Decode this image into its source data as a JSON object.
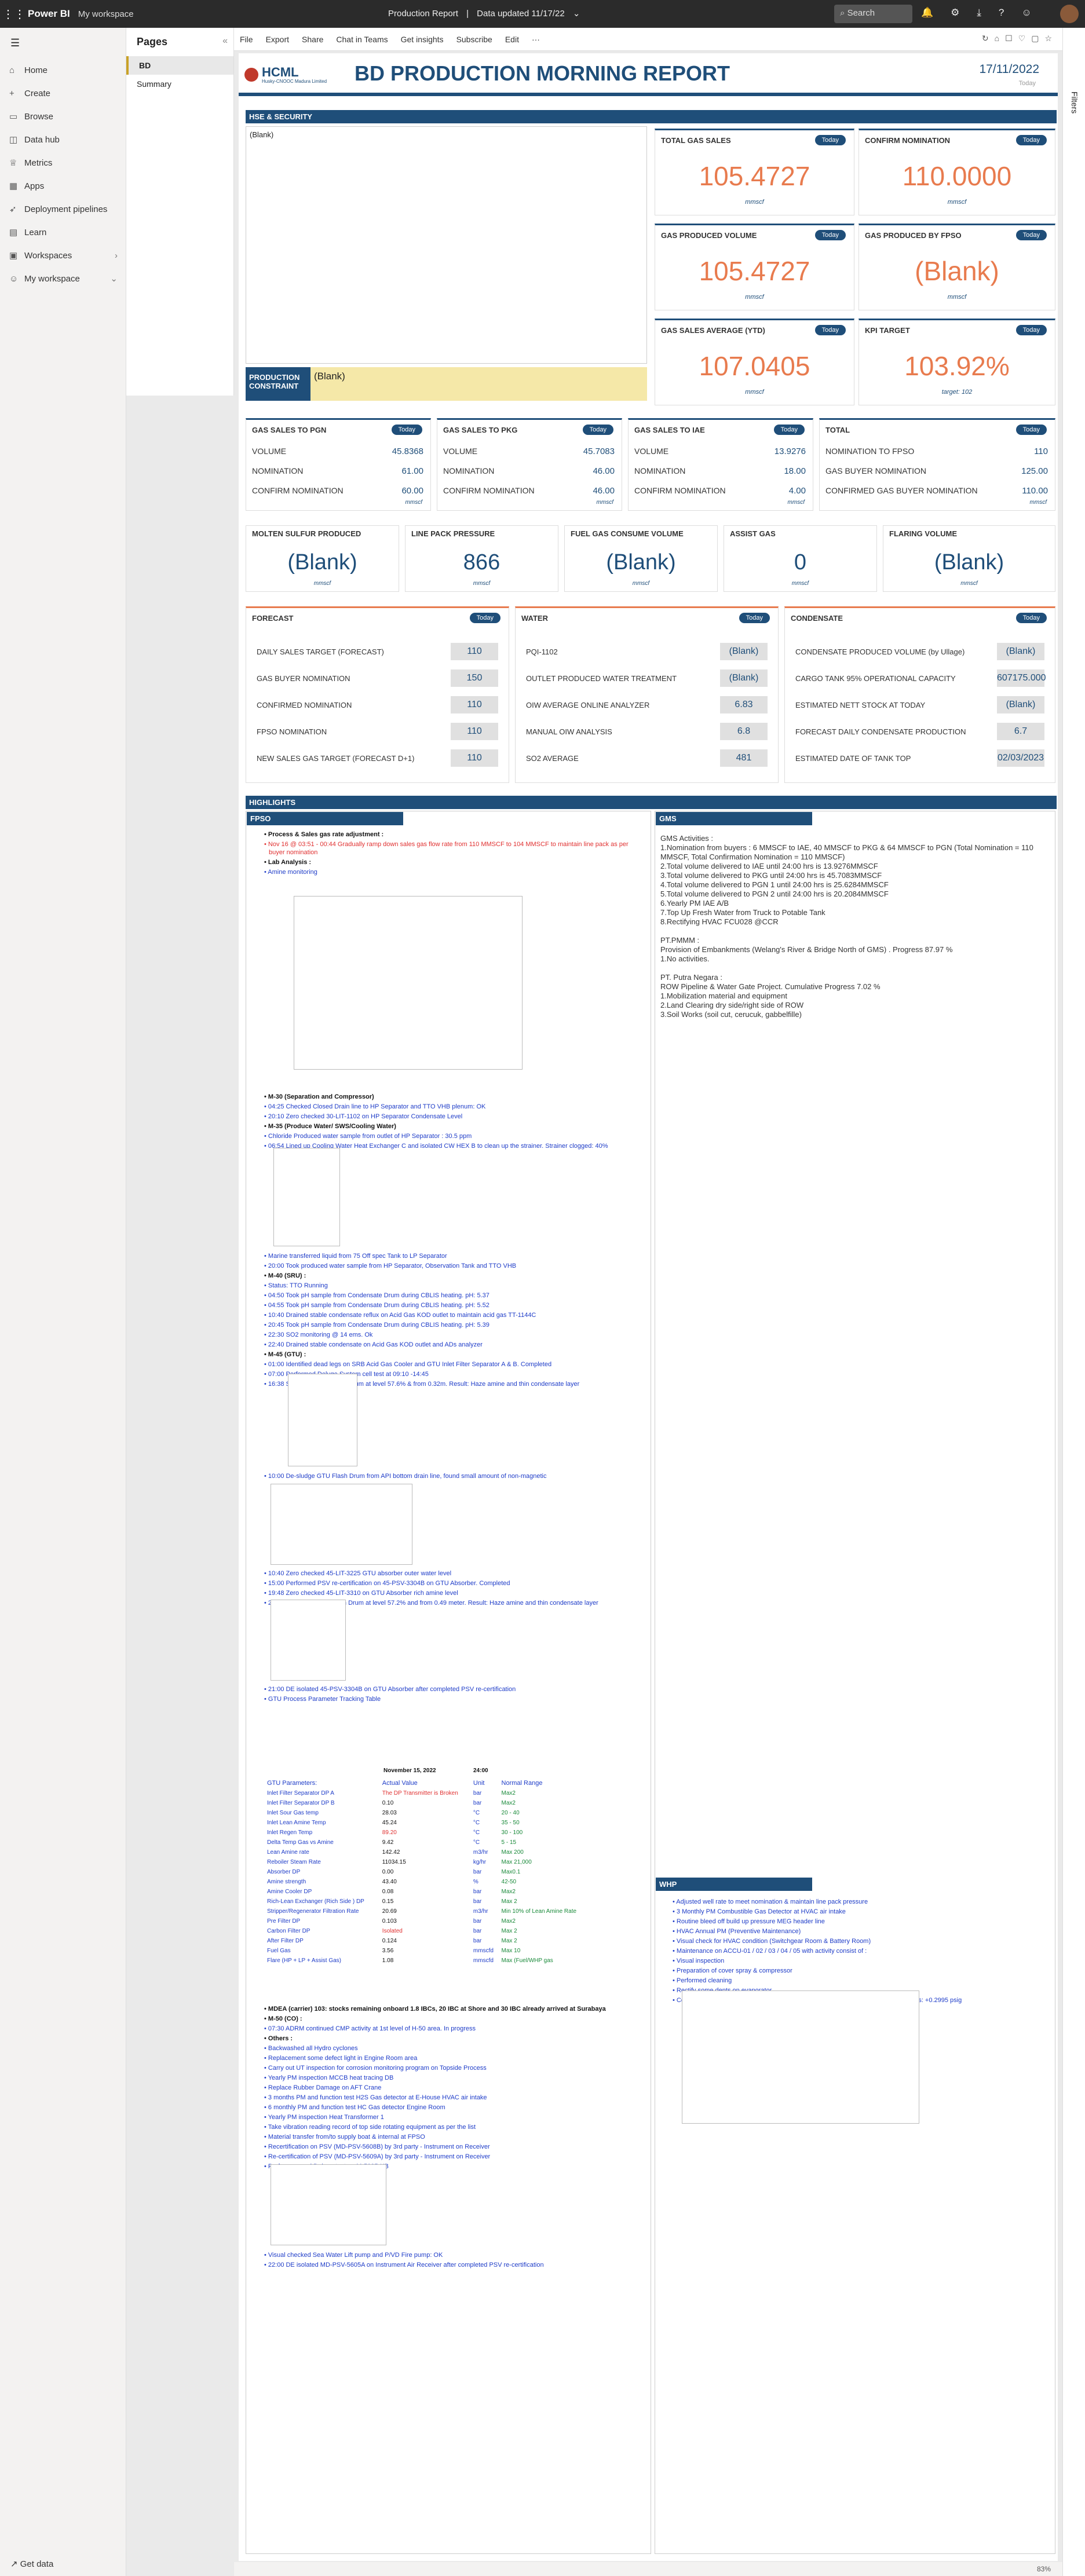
{
  "app": {
    "brand": "Power BI",
    "workspace": "My workspace",
    "report_title": "Production Report",
    "updated": "Data updated 11/17/22",
    "search_placeholder": "Search"
  },
  "nav": {
    "items": [
      "Home",
      "Create",
      "Browse",
      "Data hub",
      "Metrics",
      "Apps",
      "Deployment pipelines",
      "Learn",
      "Workspaces",
      "My workspace"
    ],
    "get_data": "Get data"
  },
  "pages": {
    "title": "Pages",
    "items": [
      "BD",
      "Summary"
    ]
  },
  "toolbar": {
    "items": [
      "File",
      "Export",
      "Share",
      "Chat in Teams",
      "Get insights",
      "Subscribe",
      "Edit"
    ]
  },
  "filters": "Filters",
  "zoom": "83%",
  "report": {
    "logo_text": "HCML",
    "logo_sub": "Husky-CNOOC Madura Limited",
    "title": "BD PRODUCTION MORNING REPORT",
    "date": "17/11/2022",
    "day": "Today",
    "hse_label": "HSE & SECURITY",
    "hse_value": "(Blank)",
    "prod_constraint_label": "PRODUCTION CONSTRAINT",
    "prod_constraint_value": "(Blank)",
    "today": "Today",
    "unit": "mmscf",
    "kpis": [
      {
        "title": "TOTAL GAS SALES",
        "value": "105.4727",
        "unit": "mmscf"
      },
      {
        "title": "CONFIRM NOMINATION",
        "value": "110.0000",
        "unit": "mmscf"
      },
      {
        "title": "GAS PRODUCED VOLUME",
        "value": "105.4727",
        "unit": "mmscf"
      },
      {
        "title": "GAS PRODUCED BY FPSO",
        "value": "(Blank)",
        "unit": "mmscf"
      },
      {
        "title": "GAS SALES AVERAGE (YTD)",
        "value": "107.0405",
        "unit": "mmscf"
      },
      {
        "title": "KPI TARGET",
        "value": "103.92%",
        "unit": "target: 102"
      }
    ],
    "sales": [
      {
        "title": "GAS SALES TO PGN",
        "rows": [
          [
            "VOLUME",
            "45.8368"
          ],
          [
            "NOMINATION",
            "61.00"
          ],
          [
            "CONFIRM NOMINATION",
            "60.00"
          ]
        ],
        "unit": "mmscf"
      },
      {
        "title": "GAS SALES TO PKG",
        "rows": [
          [
            "VOLUME",
            "45.7083"
          ],
          [
            "NOMINATION",
            "46.00"
          ],
          [
            "CONFIRM NOMINATION",
            "46.00"
          ]
        ],
        "unit": "mmscf"
      },
      {
        "title": "GAS SALES TO IAE",
        "rows": [
          [
            "VOLUME",
            "13.9276"
          ],
          [
            "NOMINATION",
            "18.00"
          ],
          [
            "CONFIRM NOMINATION",
            "4.00"
          ]
        ],
        "unit": "mmscf"
      },
      {
        "title": "TOTAL",
        "rows": [
          [
            "NOMINATION TO FPSO",
            "110"
          ],
          [
            "GAS BUYER NOMINATION",
            "125.00"
          ],
          [
            "CONFIRMED GAS BUYER NOMINATION",
            "110.00"
          ]
        ],
        "unit": "mmscf"
      }
    ],
    "misc": [
      {
        "title": "MOLTEN SULFUR PRODUCED",
        "value": "(Blank)",
        "unit": "mmscf"
      },
      {
        "title": "LINE PACK PRESSURE",
        "value": "866",
        "unit": "mmscf"
      },
      {
        "title": "FUEL GAS CONSUME VOLUME",
        "value": "(Blank)",
        "unit": "mmscf"
      },
      {
        "title": "ASSIST GAS",
        "value": "0",
        "unit": "mmscf"
      },
      {
        "title": "FLARING VOLUME",
        "value": "(Blank)",
        "unit": "mmscf"
      }
    ],
    "forecast": {
      "title": "FORECAST",
      "rows": [
        [
          "DAILY SALES TARGET (FORECAST)",
          "110"
        ],
        [
          "GAS BUYER NOMINATION",
          "150"
        ],
        [
          "CONFIRMED NOMINATION",
          "110"
        ],
        [
          "FPSO NOMINATION",
          "110"
        ],
        [
          "NEW SALES GAS TARGET (FORECAST D+1)",
          "110"
        ]
      ]
    },
    "water": {
      "title": "WATER",
      "rows": [
        [
          "PQI-1102",
          "(Blank)"
        ],
        [
          "OUTLET PRODUCED WATER TREATMENT",
          "(Blank)"
        ],
        [
          "OIW AVERAGE ONLINE ANALYZER",
          "6.83"
        ],
        [
          "MANUAL OIW ANALYSIS",
          "6.8"
        ],
        [
          "SO2 AVERAGE",
          "481"
        ]
      ]
    },
    "condensate": {
      "title": "CONDENSATE",
      "rows": [
        [
          "CONDENSATE PRODUCED VOLUME (by Ullage)",
          "(Blank)"
        ],
        [
          "CARGO TANK 95% OPERATIONAL CAPACITY",
          "607175.000"
        ],
        [
          "ESTIMATED NETT STOCK AT TODAY",
          "(Blank)"
        ],
        [
          "FORECAST DAILY CONDENSATE PRODUCTION",
          "6.7"
        ],
        [
          "ESTIMATED DATE OF TANK TOP",
          "02/03/2023"
        ]
      ]
    },
    "highlights": "HIGHLIGHTS",
    "fpso": "FPSO",
    "gms_label": "GMS",
    "whp_label": "WHP",
    "fpso_lines_a": [
      {
        "t": "Process & Sales gas rate adjustment :",
        "c": "blk"
      },
      {
        "t": "Nov 16 @ 03:51 - 00:44 Gradually ramp down sales gas flow rate from 110 MMSCF to 104 MMSCF to maintain line pack as per buyer nomination",
        "c": "red"
      },
      {
        "t": "Lab Analysis :",
        "c": "blk"
      },
      {
        "t": "Amine monitoring",
        "c": ""
      }
    ],
    "fpso_lines_b": [
      {
        "t": "M-30 (Separation and Compressor)",
        "c": "blk"
      },
      {
        "t": "04:25 Checked Closed Drain line to HP Separator and TTO VHB plenum: OK",
        "c": ""
      },
      {
        "t": "20:10 Zero checked 30-LIT-1102 on HP Separator Condensate Level",
        "c": ""
      },
      {
        "t": "M-35 (Produce Water/ SWS/Cooling Water)",
        "c": "blk"
      },
      {
        "t": "Chloride Produced water sample from outlet of HP Separator : 30.5 ppm",
        "c": ""
      },
      {
        "t": "06:54 Lined up Cooling Water Heat Exchanger C and isolated CW HEX B to clean up the strainer. Strainer clogged: 40%",
        "c": ""
      }
    ],
    "fpso_lines_c": [
      {
        "t": "Marine transferred liquid from 75 Off spec Tank to LP Separator",
        "c": ""
      },
      {
        "t": "20:00 Took produced water sample from HP Separator, Observation Tank and TTO VHB",
        "c": ""
      },
      {
        "t": "M-40 (SRU) :",
        "c": "blk"
      },
      {
        "t": "Status: TTO Running",
        "c": ""
      },
      {
        "t": "04:50 Took pH sample from Condensate Drum during CBLIS heating. pH: 5.37",
        "c": ""
      },
      {
        "t": "04:55 Took pH sample from Condensate Drum during CBLIS heating. pH: 5.52",
        "c": ""
      },
      {
        "t": "10:40 Drained stable condensate reflux on Acid Gas KOD outlet to maintain acid gas TT-1144C",
        "c": ""
      },
      {
        "t": "20:45 Took pH sample from Condensate Drum during CBLIS heating. pH: 5.39",
        "c": ""
      },
      {
        "t": "22:30 SO2 monitoring @ 14 ems. Ok",
        "c": ""
      },
      {
        "t": "22:40 Drained stable condensate on Acid Gas KOD outlet and ADs analyzer",
        "c": ""
      },
      {
        "t": "M-45 (GTU) :",
        "c": "blk"
      },
      {
        "t": "01:00 Identified dead legs on SRB Acid Gas Cooler and GTU Inlet Filter Separator A & B. Completed",
        "c": ""
      },
      {
        "t": "07:00 Performed Deluge System cell test at 09:10 -14:45",
        "c": ""
      },
      {
        "t": "16:38 Skimming GTU Flash Drum at level 57.6% & from 0.32m. Result: Haze amine and thin condensate layer",
        "c": ""
      }
    ],
    "fpso_lines_d": [
      {
        "t": "10:00 De-sludge GTU Flash Drum from API bottom drain line, found small amount of non-magnetic",
        "c": ""
      }
    ],
    "fpso_lines_e": [
      {
        "t": "10:40 Zero checked 45-LIT-3225 GTU absorber outer water level",
        "c": ""
      },
      {
        "t": "15:00 Performed PSV re-certification on 45-PSV-3304B on GTU Absorber. Completed",
        "c": ""
      },
      {
        "t": "19:48 Zero checked 45-LIT-3310 on GTU Absorber rich amine level",
        "c": ""
      },
      {
        "t": "20:55 Skimming GTU Flash Drum at level 57.2% and from 0.49 meter. Result: Haze amine and thin condensate layer",
        "c": ""
      }
    ],
    "fpso_lines_f": [
      {
        "t": "21:00 DE isolated 45-PSV-3304B on GTU Absorber after completed PSV re-certification",
        "c": ""
      },
      {
        "t": "GTU Process Parameter Tracking Table",
        "c": ""
      }
    ],
    "gtu": {
      "date": "November 15, 2022",
      "time": "24:00",
      "headers": [
        "GTU Parameters:",
        "Actual Value",
        "Unit",
        "Normal Range"
      ],
      "rows": [
        [
          "Inlet Filter Separator DP A",
          "The DP Transmitter is Broken",
          "bar",
          "Max2"
        ],
        [
          "Inlet Filter Separator DP B",
          "0.10",
          "bar",
          "Max2"
        ],
        [
          "Inlet Sour Gas temp",
          "28.03",
          "°C",
          "20 - 40"
        ],
        [
          "Inlet Lean Amine Temp",
          "45.24",
          "°C",
          "35 - 50"
        ],
        [
          "Inlet Regen Temp",
          "89.20",
          "°C",
          "30 - 100"
        ],
        [
          "Delta Temp Gas vs Amine",
          "9.42",
          "°C",
          "5 - 15"
        ],
        [
          "Lean Amine rate",
          "142.42",
          "m3/hr",
          "Max 200"
        ],
        [
          "Reboiler Steam Rate",
          "11034.15",
          "kg/hr",
          "Max 21,000"
        ],
        [
          "Absorber DP",
          "0.00",
          "bar",
          "Max0.1"
        ],
        [
          "Amine strength",
          "43.40",
          "%",
          "42-50"
        ],
        [
          "Amine Cooler DP",
          "0.08",
          "bar",
          "Max2"
        ],
        [
          "Rich-Lean Exchanger (Rich Side ) DP",
          "0.15",
          "bar",
          "Max 2"
        ],
        [
          "Stripper/Regenerator Filtration Rate",
          "20.69",
          "m3/hr",
          "Min 10% of Lean Amine Rate"
        ],
        [
          "Pre Filter DP",
          "0.103",
          "bar",
          "Max2"
        ],
        [
          "Carbon Filter DP",
          "Isolated",
          "bar",
          "Max 2"
        ],
        [
          "After Filter DP",
          "0.124",
          "bar",
          "Max 2"
        ],
        [
          "Fuel Gas",
          "3.56",
          "mmscfd",
          "Max 10"
        ],
        [
          "Flare (HP + LP + Assist Gas)",
          "1.08",
          "mmscfd",
          "Max (Fuel/WHP gas"
        ]
      ]
    },
    "fpso_lines_g": [
      {
        "t": "MDEA (carrier) 103: stocks remaining onboard 1.8 IBCs, 20 IBC at Shore and 30 IBC already arrived at Surabaya",
        "c": "blk"
      },
      {
        "t": "M-50 (CO) :",
        "c": "blk"
      },
      {
        "t": "07:30 ADRM continued CMP activity at 1st level of H-50 area. In progress",
        "c": ""
      },
      {
        "t": "Others :",
        "c": "blk"
      },
      {
        "t": "Backwashed all Hydro cyclones",
        "c": ""
      },
      {
        "t": "Replacement some defect light in Engine Room area",
        "c": ""
      },
      {
        "t": "Carry out UT inspection for corrosion monitoring program on Topside Process",
        "c": ""
      },
      {
        "t": "Yearly PM inspection MCCB heat tracing DB",
        "c": ""
      },
      {
        "t": "Replace Rubber Damage on AFT Crane",
        "c": ""
      },
      {
        "t": "3 months PM and function test H2S Gas detector at E-House HVAC air intake",
        "c": ""
      },
      {
        "t": "6 monthly PM and function test HC Gas detector Engine Room",
        "c": ""
      },
      {
        "t": "Yearly PM inspection Heat Transformer 1",
        "c": ""
      },
      {
        "t": "Take vibration reading record of top side rotating equipment as per the list",
        "c": ""
      },
      {
        "t": "Material transfer from/to supply boat & internal at FPSO",
        "c": ""
      },
      {
        "t": "Recertification on PSV (MD-PSV-5608B) by 3rd party - Instrument on Receiver",
        "c": ""
      },
      {
        "t": "Re-certification of PSV (MD-PSV-5609A) by 3rd party - Instrument on Receiver",
        "c": ""
      },
      {
        "t": "Perform annual Deluge test on M-5095-KB",
        "c": ""
      }
    ],
    "fpso_lines_h": [
      {
        "t": "Visual checked Sea Water Lift pump and P/VD Fire pump: OK",
        "c": ""
      },
      {
        "t": "22:00 DE isolated MD-PSV-5605A on Instrument Air Receiver after completed PSV re-certification",
        "c": ""
      }
    ],
    "gms_text": [
      "GMS Activities :",
      "1.Nomination from buyers : 6 MMSCF to IAE, 40 MMSCF to PKG & 64 MMSCF to PGN (Total Nomination = 110 MMSCF, Total Confirmation Nomination = 110 MMSCF)",
      "2.Total volume delivered to IAE until 24:00 hrs is 13.9276MMSCF",
      "3.Total volume delivered to PKG until 24:00 hrs is 45.7083MMSCF",
      "4.Total volume delivered to PGN 1 until 24:00 hrs is 25.6284MMSCF",
      "5.Total volume delivered to PGN 2 until 24:00 hrs is 20.2084MMSCF",
      "6.Yearly PM IAE A/B",
      "7.Top Up Fresh Water from Truck to Potable Tank",
      "8.Rectifying HVAC FCU028 @CCR",
      "",
      "PT.PMMM :",
      "Provision of Embankments (Welang's River & Bridge North of GMS) . Progress 87.97 %",
      "1.No activities.",
      "",
      "PT. Putra Negara :",
      "ROW Pipeline & Water Gate Project. Cumulative Progress 7.02 %",
      "1.Mobilization material and equipment",
      "2.Land Clearing dry side/right side of ROW",
      "3.Soil Works (soil cut, cerucuk, gabbelfille)"
    ],
    "whp_lines": [
      {
        "t": "Adjusted well rate to meet nomination & maintain line pack pressure",
        "c": ""
      },
      {
        "t": "3 Monthly PM Combustible Gas Detector at HVAC air intake",
        "c": ""
      },
      {
        "t": "Routine bleed off build up pressure MEG header line",
        "c": ""
      },
      {
        "t": "HVAC Annual PM (Preventive Maintenance)",
        "c": ""
      },
      {
        "t": "Visual check for HVAC condition (Switchgear Room & Battery Room)",
        "c": ""
      },
      {
        "t": "Maintenance on ACCU-01 / 02 / 03 / 04 / 05 with activity consist of :",
        "c": ""
      },
      {
        "t": "Visual inspection",
        "c": ""
      },
      {
        "t": "Preparation of cover spray & compressor",
        "c": ""
      },
      {
        "t": "Performed cleaning",
        "c": ""
      },
      {
        "t": "Rectify some dents on evaporator",
        "c": ""
      },
      {
        "t": "Continued monitoring Tubing Pressure well-01. Pressure different increase by in 24 hrs: +0.2995 psig",
        "c": ""
      }
    ]
  }
}
